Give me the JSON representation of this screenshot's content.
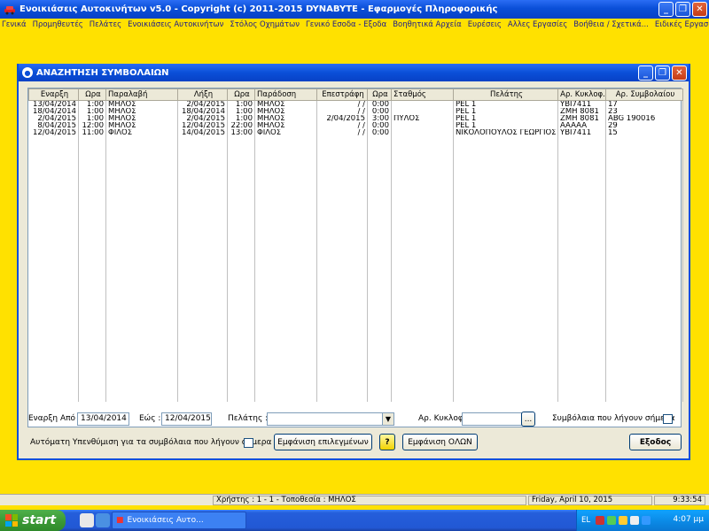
{
  "app": {
    "title": "Ενοικιάσεις Αυτοκινήτων  v5.0  -  Copyright (c)  2011-2015  DYNABYTE - Εφαρμογές Πληροφορικής"
  },
  "menu": [
    "Γενικά",
    "Προμηθευτές",
    "Πελάτες",
    "Ενοικιάσεις Αυτοκινήτων",
    "Στόλος Οχημάτων",
    "Γενικό Εσοδα - Εξοδα",
    "Βοηθητικά Αρχεία",
    "Ευρέσεις",
    "Αλλες Εργασίες",
    "Βοήθεια / Σχετικά...",
    "Ειδικές Εργασίες"
  ],
  "dialog": {
    "title": "ΑΝΑΖΗΤΗΣΗ ΣΥΜΒΟΛΑΙΩΝ"
  },
  "table": {
    "headers": [
      "Εναρξη",
      "Ωρα",
      "Παραλαβή",
      "Λήξη",
      "Ωρα",
      "Παράδοση",
      "Επεστράφη",
      "Ωρα",
      "Σταθμός",
      "Πελάτης",
      "Αρ. Κυκλοφ.",
      "Αρ. Συμβολαίου"
    ],
    "rows": [
      [
        "13/04/2014",
        "1:00",
        "ΜΗΛΟΣ",
        "2/04/2015",
        "1:00",
        "ΜΗΛΟΣ",
        "/ /",
        "0:00",
        "",
        "PEL 1",
        "ΥΒΙ7411",
        "17"
      ],
      [
        "18/04/2014",
        "1:00",
        "ΜΗΛΟΣ",
        "18/04/2014",
        "1:00",
        "ΜΗΛΟΣ",
        "/ /",
        "0:00",
        "",
        "PEL 1",
        "ΖΜΗ 8081",
        "23"
      ],
      [
        "2/04/2015",
        "1:00",
        "ΜΗΛΟΣ",
        "2/04/2015",
        "1:00",
        "ΜΗΛΟΣ",
        "2/04/2015",
        "3:00",
        "ΠΥΛΟΣ",
        "PEL 1",
        "ΖΜΗ 8081",
        "ABG 190016"
      ],
      [
        "8/04/2015",
        "12:00",
        "ΜΗΛΟΣ",
        "12/04/2015",
        "22:00",
        "ΜΗΛΟΣ",
        "/ /",
        "0:00",
        "",
        "PEL 1",
        "AAAAA",
        "29"
      ],
      [
        "12/04/2015",
        "11:00",
        "ΦΙΛΟΣ",
        "14/04/2015",
        "13:00",
        "ΦΙΛΟΣ",
        "/ /",
        "0:00",
        "",
        "ΝΙΚΟΛΟΠΟΥΛΟΣ ΓΕΩΡΓΙΟΣ",
        "ΥΒΙ7411",
        "15"
      ]
    ]
  },
  "filters": {
    "start_label": "Εναρξη Από :",
    "start_value": "13/04/2014",
    "to_label": "Εώς :",
    "to_value": "12/04/2015",
    "customer_label": "Πελάτης :",
    "customer_value": "",
    "plate_label": "Αρ. Κυκλοφ :",
    "plate_value": "",
    "browse_label": "...",
    "expiring_label": "Συμβόλαια που λήγουν σήμερα",
    "reminder_label": "Αυτόματη Υπενθύμιση για τα συμβόλαια που λήγουν σήμερα"
  },
  "buttons": {
    "show_selected": "Εμφάνιση επιλεγμένων",
    "help": "?",
    "show_all": "Εμφάνιση ΟΛΩΝ",
    "exit": "Εξοδος"
  },
  "status": {
    "user": "Χρήστης : 1 - 1  -  Τοποθεσία : ΜΗΛΟΣ",
    "date": "Friday, April 10, 2015",
    "time": "9:33:54"
  },
  "taskbar": {
    "start": "start",
    "task": "Ενοικιάσεις Αυτο...",
    "lang": "EL",
    "clock": "4:07 μμ"
  }
}
